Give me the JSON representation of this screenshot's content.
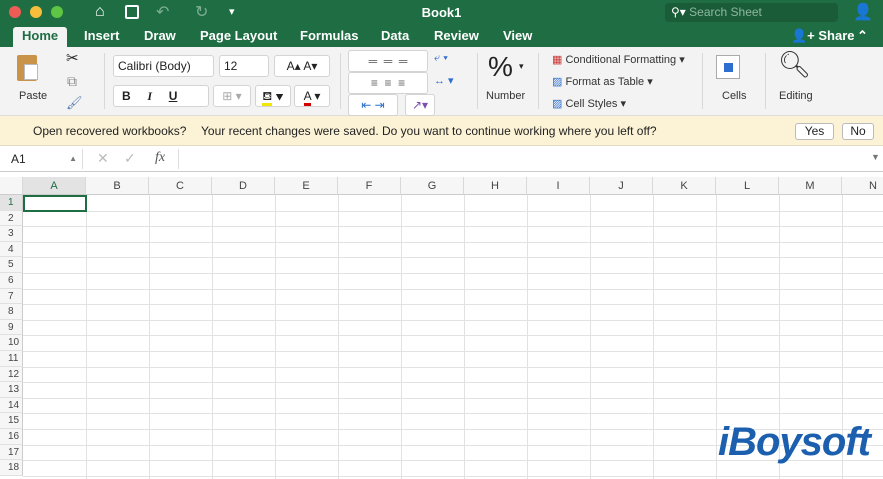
{
  "window": {
    "title": "Book1",
    "search_placeholder": "Search Sheet",
    "colors": {
      "brand": "#1f6e43",
      "close": "#ee5c55",
      "minimize": "#f6be3b",
      "zoom": "#5fc645"
    }
  },
  "tabs": [
    {
      "label": "Home",
      "active": true
    },
    {
      "label": "Insert"
    },
    {
      "label": "Draw"
    },
    {
      "label": "Page Layout"
    },
    {
      "label": "Formulas"
    },
    {
      "label": "Data"
    },
    {
      "label": "Review"
    },
    {
      "label": "View"
    }
  ],
  "share_label": "Share",
  "ribbon": {
    "paste": "Paste",
    "font_name": "Calibri (Body)",
    "font_size": "12",
    "bold": "B",
    "italic": "I",
    "underline": "U",
    "grow": "A",
    "shrink": "A",
    "font_color": "A",
    "number": "Number",
    "conditional_formatting": "Conditional Formatting",
    "format_as_table": "Format as Table",
    "cell_styles": "Cell Styles",
    "cells": "Cells",
    "editing": "Editing"
  },
  "info_bar": {
    "title": "Open recovered workbooks?",
    "message": "Your recent changes were saved. Do you want to continue working where you left off?",
    "yes": "Yes",
    "no": "No"
  },
  "formula_bar": {
    "name_box": "A1",
    "fx": "fx",
    "value": ""
  },
  "columns": [
    "A",
    "B",
    "C",
    "D",
    "E",
    "F",
    "G",
    "H",
    "I",
    "J",
    "K",
    "L",
    "M",
    "N"
  ],
  "rows": [
    "1",
    "2",
    "3",
    "4",
    "5",
    "6",
    "7",
    "8",
    "9",
    "10",
    "11",
    "12",
    "13",
    "14",
    "15",
    "16",
    "17",
    "18"
  ],
  "selected_cell": "A1",
  "watermark": "iBoysoft"
}
